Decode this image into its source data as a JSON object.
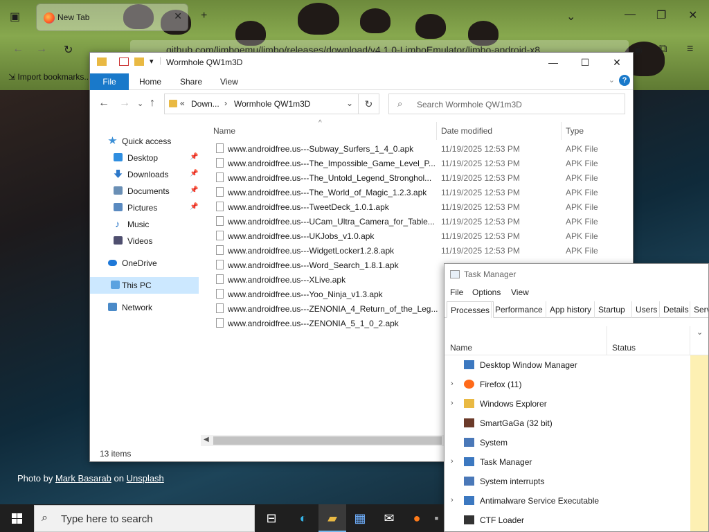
{
  "firefox": {
    "tab_title": "New Tab",
    "url": "github.com/limboemu/limbo/releases/download/v4.1.0-LimboEmulator/limbo-android-x8",
    "bookmarks_label": "Import bookmarks..."
  },
  "explorer": {
    "title": "Wormhole QW1m3D",
    "ribbon": {
      "file": "File",
      "home": "Home",
      "share": "Share",
      "view": "View"
    },
    "address": {
      "crumb_1": "Down...",
      "crumb_2": "Wormhole QW1m3D"
    },
    "search_placeholder": "Search Wormhole QW1m3D",
    "columns": {
      "name": "Name",
      "date": "Date modified",
      "type": "Type"
    },
    "sidebar": [
      {
        "label": "Quick access",
        "icon": "star-icon"
      },
      {
        "label": "Desktop",
        "icon": "desktop-icon",
        "pinned": true
      },
      {
        "label": "Downloads",
        "icon": "download-icon",
        "pinned": true
      },
      {
        "label": "Documents",
        "icon": "documents-icon",
        "pinned": true
      },
      {
        "label": "Pictures",
        "icon": "pictures-icon",
        "pinned": true
      },
      {
        "label": "Music",
        "icon": "music-icon"
      },
      {
        "label": "Videos",
        "icon": "videos-icon"
      },
      {
        "label": "OneDrive",
        "icon": "onedrive-icon"
      },
      {
        "label": "This PC",
        "icon": "computer-icon"
      },
      {
        "label": "Network",
        "icon": "network-icon"
      }
    ],
    "files": [
      {
        "name": "www.androidfree.us---Subway_Surfers_1_4_0.apk",
        "date": "11/19/2025 12:53 PM",
        "type": "APK File"
      },
      {
        "name": "www.androidfree.us---The_Impossible_Game_Level_P...",
        "date": "11/19/2025 12:53 PM",
        "type": "APK File"
      },
      {
        "name": "www.androidfree.us---The_Untold_Legend_Stronghol...",
        "date": "11/19/2025 12:53 PM",
        "type": "APK File"
      },
      {
        "name": "www.androidfree.us---The_World_of_Magic_1.2.3.apk",
        "date": "11/19/2025 12:53 PM",
        "type": "APK File"
      },
      {
        "name": "www.androidfree.us---TweetDeck_1.0.1.apk",
        "date": "11/19/2025 12:53 PM",
        "type": "APK File"
      },
      {
        "name": "www.androidfree.us---UCam_Ultra_Camera_for_Table...",
        "date": "11/19/2025 12:53 PM",
        "type": "APK File"
      },
      {
        "name": "www.androidfree.us---UKJobs_v1.0.apk",
        "date": "11/19/2025 12:53 PM",
        "type": "APK File"
      },
      {
        "name": "www.androidfree.us---WidgetLocker1.2.8.apk",
        "date": "11/19/2025 12:53 PM",
        "type": "APK File"
      },
      {
        "name": "www.androidfree.us---Word_Search_1.8.1.apk",
        "date": "",
        "type": ""
      },
      {
        "name": "www.androidfree.us---XLive.apk",
        "date": "",
        "type": ""
      },
      {
        "name": "www.androidfree.us---Yoo_Ninja_v1.3.apk",
        "date": "",
        "type": ""
      },
      {
        "name": "www.androidfree.us---ZENONIA_4_Return_of_the_Leg...",
        "date": "",
        "type": ""
      },
      {
        "name": "www.androidfree.us---ZENONIA_5_1_0_2.apk",
        "date": "",
        "type": ""
      }
    ],
    "status": "13 items"
  },
  "credit": {
    "prefix": "Photo by",
    "author": "Mark Basarab",
    "on": "on",
    "site": "Unsplash"
  },
  "taskmanager": {
    "title": "Task Manager",
    "menu": {
      "file": "File",
      "options": "Options",
      "view": "View"
    },
    "tabs": [
      "Processes",
      "Performance",
      "App history",
      "Startup",
      "Users",
      "Details",
      "Serv"
    ],
    "columns": {
      "name": "Name",
      "status": "Status"
    },
    "processes": [
      {
        "name": "Desktop Window Manager",
        "expandable": false
      },
      {
        "name": "Firefox (11)",
        "expandable": true
      },
      {
        "name": "Windows Explorer",
        "expandable": true
      },
      {
        "name": "SmartGaGa (32 bit)",
        "expandable": false
      },
      {
        "name": "System",
        "expandable": false
      },
      {
        "name": "Task Manager",
        "expandable": true
      },
      {
        "name": "System interrupts",
        "expandable": false
      },
      {
        "name": "Antimalware Service Executable",
        "expandable": true
      },
      {
        "name": "CTF Loader",
        "expandable": false
      }
    ]
  },
  "taskbar": {
    "search_placeholder": "Type here to search"
  },
  "colors": {
    "accent": "#1979ca",
    "selection": "#cce8ff",
    "taskbar": "#1f1f1f"
  }
}
